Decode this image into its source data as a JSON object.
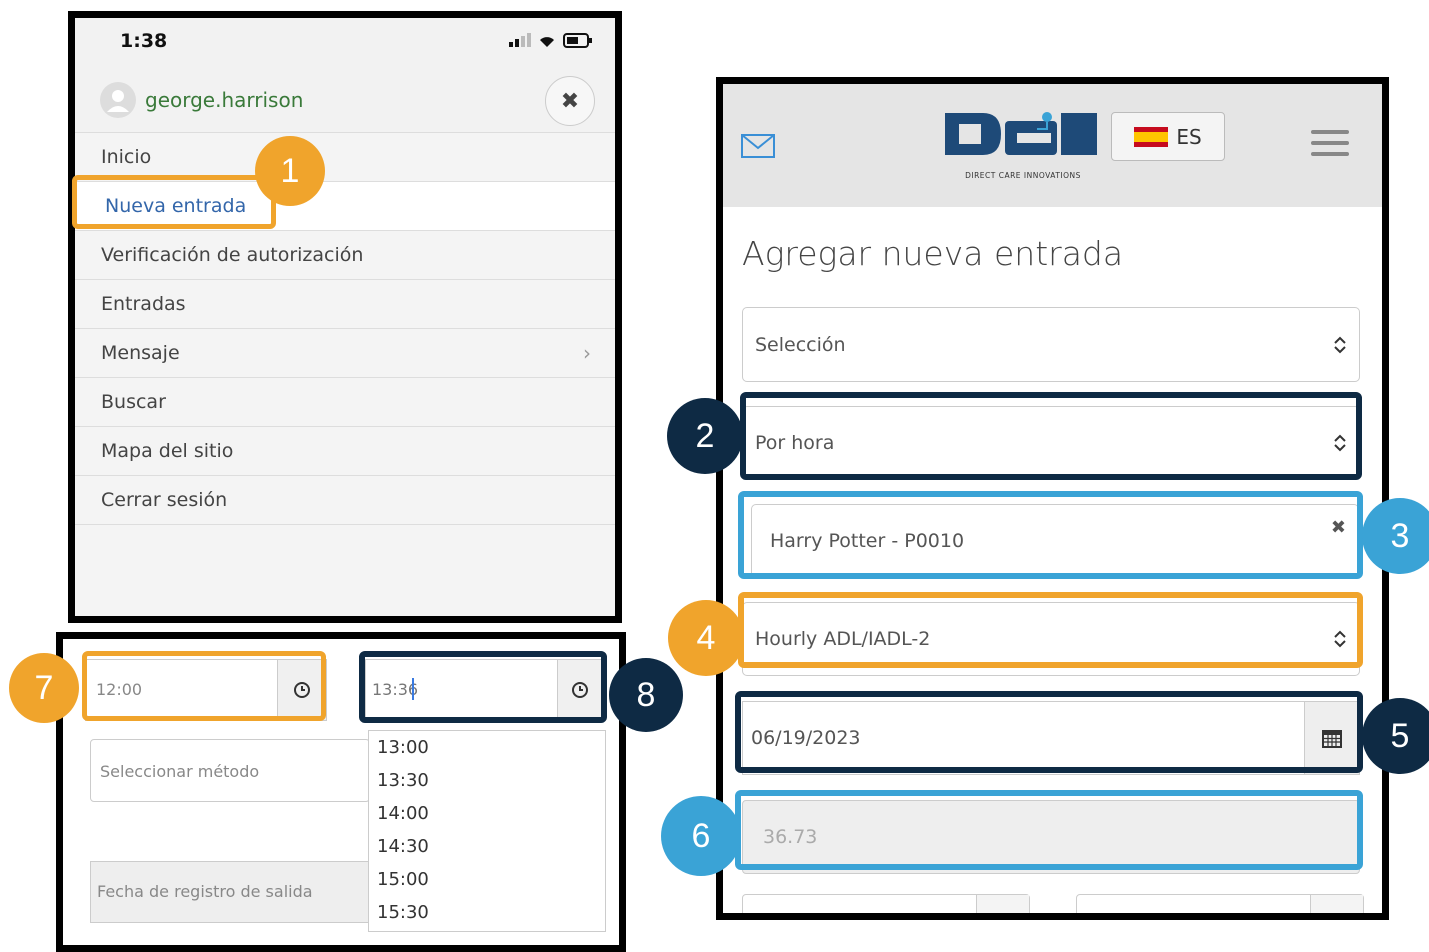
{
  "phone": {
    "time": "1:38",
    "username": "george.harrison",
    "menu": [
      {
        "label": "Inicio"
      },
      {
        "label": "Nueva entrada"
      },
      {
        "label": "Verificación de autorización"
      },
      {
        "label": "Entradas"
      },
      {
        "label": "Mensaje"
      },
      {
        "label": "Buscar"
      },
      {
        "label": "Mapa del sitio"
      },
      {
        "label": "Cerrar sesión"
      }
    ]
  },
  "time_panel": {
    "start_time": "12:00",
    "end_time": "13:36",
    "method_placeholder": "Seleccionar método",
    "checkout_date_placeholder": "Fecha de registro de salida",
    "time_options": [
      "13:00",
      "13:30",
      "14:00",
      "14:30",
      "15:00",
      "15:30"
    ]
  },
  "entry_form": {
    "language": "ES",
    "logo_subtitle": "DIRECT CARE INNOVATIONS",
    "title": "Agregar nueva entrada",
    "selection": "Selección",
    "entry_type": "Por hora",
    "client": "Harry Potter - P0010",
    "service": "Hourly ADL/IADL-2",
    "date": "06/19/2023",
    "units": "36.73"
  },
  "badges": [
    "1",
    "2",
    "3",
    "4",
    "5",
    "6",
    "7",
    "8"
  ],
  "colors": {
    "orange": "#f0a42c",
    "navy": "#0e2a44",
    "blue": "#3aa3d6"
  }
}
